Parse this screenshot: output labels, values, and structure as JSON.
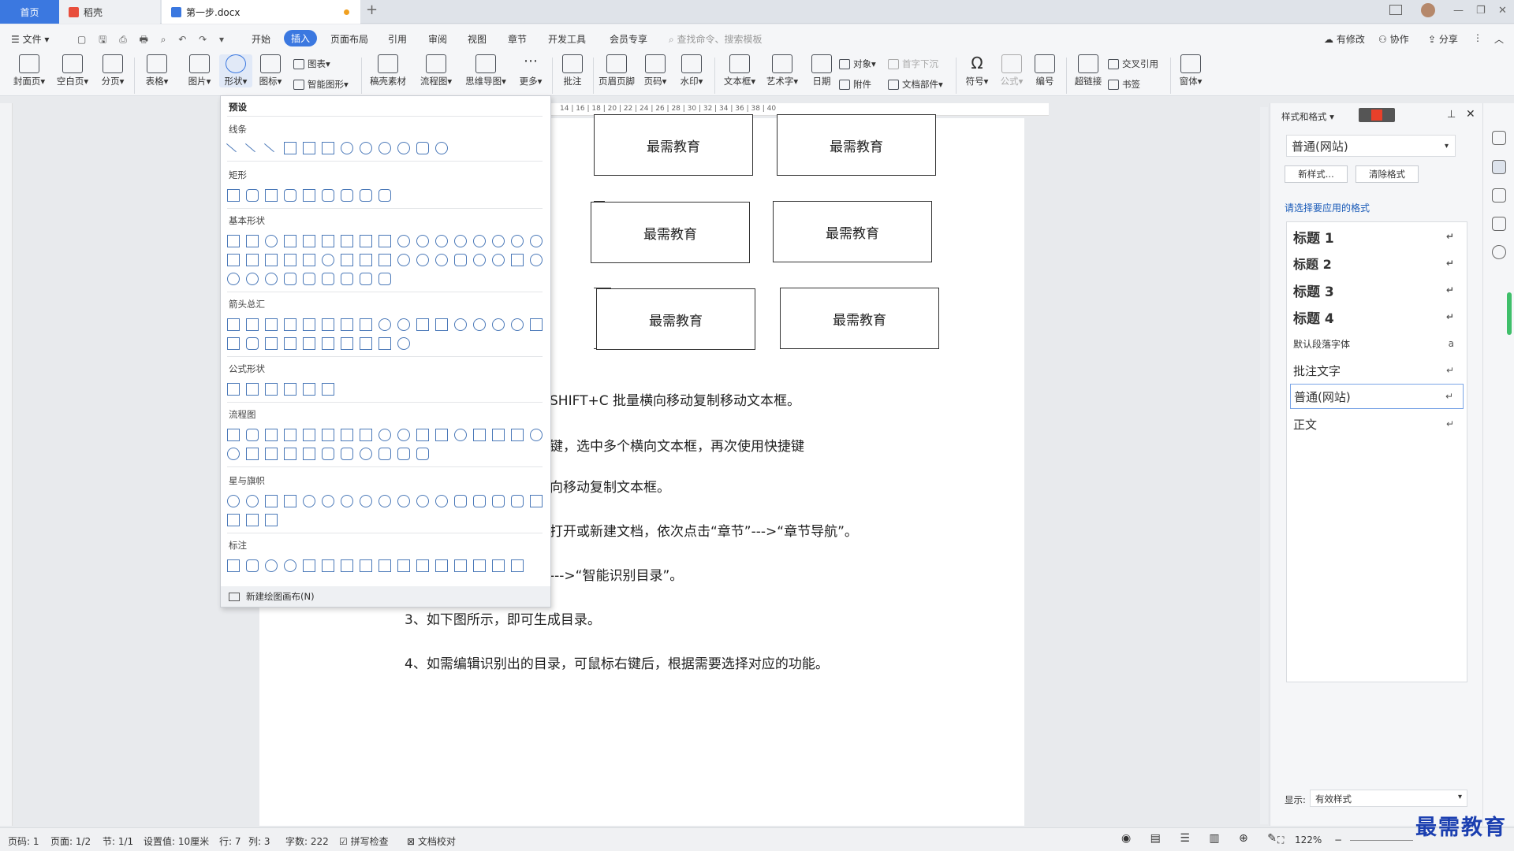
{
  "titlebar": {
    "home_tab": "首页",
    "daoke_tab": "稻壳",
    "doc_tab": "第一步.docx",
    "new_tab": "+"
  },
  "menubar": {
    "file": "文件",
    "items": [
      "开始",
      "插入",
      "页面布局",
      "引用",
      "审阅",
      "视图",
      "章节",
      "开发工具",
      "会员专享"
    ],
    "search": "查找命令、搜索模板",
    "modified": "有修改",
    "collab": "协作",
    "share": "分享"
  },
  "ribbon": {
    "cover": "封面页",
    "blank": "空白页",
    "pagebreak": "分页",
    "table": "表格",
    "picture": "图片",
    "shape": "形状",
    "icon": "图标",
    "chart": "图表",
    "smartart": "智能图形",
    "material": "稿壳素材",
    "flowchart": "流程图",
    "mindmap": "思维导图",
    "more": "更多",
    "comment": "批注",
    "header": "页眉页脚",
    "pagenum": "页码",
    "watermark": "水印",
    "textbox": "文本框",
    "wordart": "艺术字",
    "date": "日期",
    "object": "对象",
    "attach": "附件",
    "dropcap": "首字下沉",
    "docpart": "文档部件",
    "symbol": "符号",
    "formula": "公式",
    "number": "编号",
    "hyperlink": "超链接",
    "crossref": "交叉引用",
    "bookmark": "书签",
    "window": "窗体"
  },
  "shapes_panel": {
    "preset": "预设",
    "lines": "线条",
    "rect": "矩形",
    "basic": "基本形状",
    "arrows": "箭头总汇",
    "equation": "公式形状",
    "flow": "流程图",
    "stars": "星与旗帜",
    "callout": "标注",
    "new_canvas": "新建绘图画布(N)"
  },
  "document": {
    "box_label": "最需教育",
    "p1": "SHIFT+C 批量横向移动复制移动文本框。",
    "p2": "键，选中多个横向文本框，再次使用快捷键",
    "p3": "向移动复制文本框。",
    "p4": "打开或新建文档，依次点击“章节”--->“章节导航”。",
    "p5": "--->“智能识别目录”。",
    "p6": "3、如下图所示，即可生成目录。",
    "p7": "4、如需编辑识别出的目录，可鼠标右键后，根据需要选择对应的功能。"
  },
  "right_pane": {
    "title": "样式和格式",
    "current_style": "普通(网站)",
    "new_style": "新样式...",
    "clear_format": "清除格式",
    "prompt": "请选择要应用的格式",
    "styles": [
      "标题 1",
      "标题 2",
      "标题 3",
      "标题 4",
      "默认段落字体",
      "批注文字",
      "普通(网站)",
      "正文"
    ],
    "show_label": "显示:",
    "show_value": "有效样式"
  },
  "status": {
    "page": "页码: 1",
    "pages": "页面: 1/2",
    "section": "节: 1/1",
    "setting": "设置值: 10厘米",
    "row": "行: 7",
    "col": "列: 3",
    "words": "字数: 222",
    "spell": "拼写检查",
    "proof": "文档校对",
    "zoom": "122%"
  },
  "watermark": "最需教育"
}
